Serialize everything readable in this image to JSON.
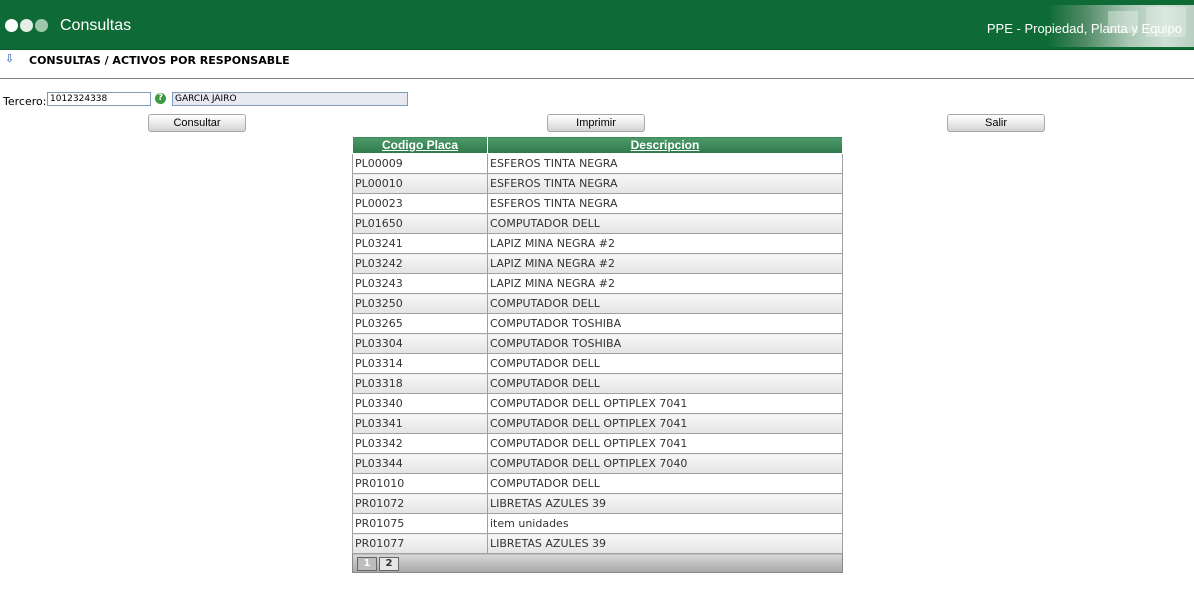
{
  "header": {
    "app_title": "Consultas",
    "subtitle": "PPE - Propiedad, Planta y Equipo"
  },
  "page": {
    "title": "CONSULTAS / ACTIVOS POR RESPONSABLE"
  },
  "form": {
    "tercero_label": "Tercero:",
    "tercero_value": "1012324338",
    "nombre_value": "GARCIA JAIRO"
  },
  "buttons": {
    "consultar": "Consultar",
    "imprimir": "Imprimir",
    "salir": "Salir"
  },
  "table": {
    "columns": [
      "Codigo Placa",
      "Descripcion"
    ],
    "rows": [
      [
        "PL00009",
        "ESFEROS TINTA NEGRA"
      ],
      [
        "PL00010",
        "ESFEROS TINTA NEGRA"
      ],
      [
        "PL00023",
        "ESFEROS TINTA NEGRA"
      ],
      [
        "PL01650",
        "COMPUTADOR DELL"
      ],
      [
        "PL03241",
        "LAPIZ MINA NEGRA #2"
      ],
      [
        "PL03242",
        "LAPIZ MINA NEGRA #2"
      ],
      [
        "PL03243",
        "LAPIZ MINA NEGRA #2"
      ],
      [
        "PL03250",
        "COMPUTADOR DELL"
      ],
      [
        "PL03265",
        "COMPUTADOR TOSHIBA"
      ],
      [
        "PL03304",
        "COMPUTADOR TOSHIBA"
      ],
      [
        "PL03314",
        "COMPUTADOR DELL"
      ],
      [
        "PL03318",
        "COMPUTADOR DELL"
      ],
      [
        "PL03340",
        "COMPUTADOR DELL OPTIPLEX 7041"
      ],
      [
        "PL03341",
        "COMPUTADOR DELL OPTIPLEX 7041"
      ],
      [
        "PL03342",
        "COMPUTADOR DELL OPTIPLEX 7041"
      ],
      [
        "PL03344",
        "COMPUTADOR DELL OPTIPLEX 7040"
      ],
      [
        "PR01010",
        "COMPUTADOR DELL"
      ],
      [
        "PR01072",
        "LIBRETAS AZULES 39"
      ],
      [
        "PR01075",
        "item unidades"
      ],
      [
        "PR01077",
        "LIBRETAS AZULES 39"
      ]
    ],
    "pager": {
      "pages": [
        "1",
        "2"
      ],
      "current": "1"
    }
  },
  "colors": {
    "header_bg": "#0e6b36",
    "grid_header": "#3a8a55"
  },
  "icons": {
    "info": "info-icon",
    "help": "help-icon"
  }
}
